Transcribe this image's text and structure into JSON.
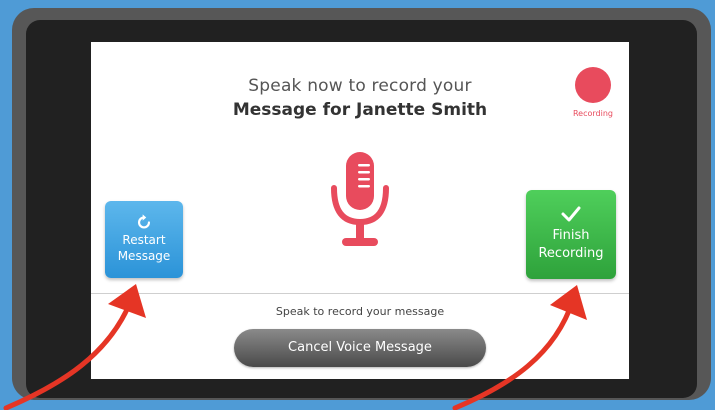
{
  "header": {
    "line1": "Speak now to record your",
    "line2": "Message for Janette Smith"
  },
  "recording_indicator": {
    "label": "Recording",
    "color": "#e84b5d"
  },
  "microphone": {
    "icon": "microphone-icon",
    "color": "#e84b5d"
  },
  "restart_button": {
    "line1": "Restart",
    "line2": "Message",
    "icon": "restart-icon",
    "color": "#2b93d8"
  },
  "finish_button": {
    "line1": "Finish",
    "line2": "Recording",
    "icon": "checkmark-icon",
    "color": "#2ea23b"
  },
  "footer": {
    "hint": "Speak to record your message",
    "cancel_label": "Cancel Voice Message"
  },
  "annotations": {
    "arrow_color": "#e53525"
  }
}
